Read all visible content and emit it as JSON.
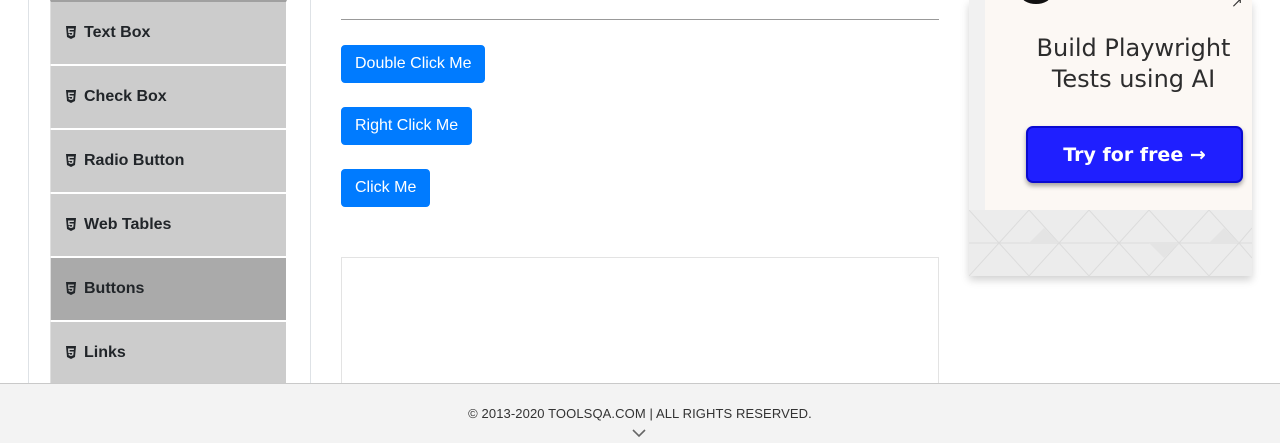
{
  "sidebar": {
    "items": [
      {
        "label": "Text Box",
        "icon": "html5-icon",
        "active": false
      },
      {
        "label": "Check Box",
        "icon": "html5-icon",
        "active": false
      },
      {
        "label": "Radio Button",
        "icon": "html5-icon",
        "active": false
      },
      {
        "label": "Web Tables",
        "icon": "html5-icon",
        "active": false
      },
      {
        "label": "Buttons",
        "icon": "html5-icon",
        "active": true
      },
      {
        "label": "Links",
        "icon": "html5-icon",
        "active": false
      }
    ]
  },
  "main": {
    "double_click_label": "Double Click Me",
    "right_click_label": "Right Click Me",
    "click_label": "Click Me"
  },
  "ad": {
    "headline_line1": "Build Playwright",
    "headline_line2": "Tests using AI",
    "cta_label": "Try for free →"
  },
  "footer": {
    "copyright": "© 2013-2020 TOOLSQA.COM | ALL RIGHTS RESERVED."
  },
  "colors": {
    "primary_button": "#007bff",
    "menu_item_bg": "#cccccc",
    "menu_item_active_bg": "#aaaaaa",
    "ad_cta": "#1f1fff"
  }
}
